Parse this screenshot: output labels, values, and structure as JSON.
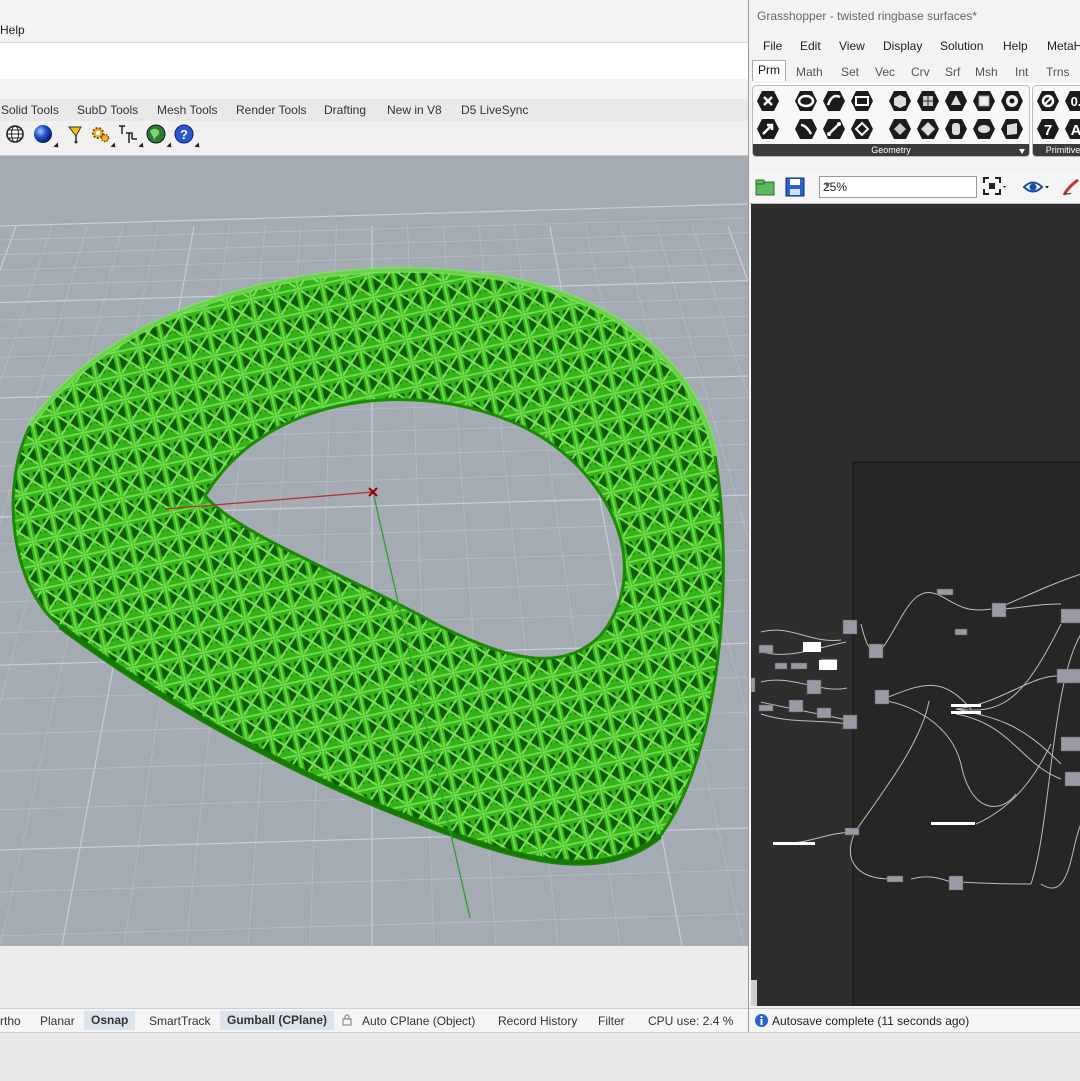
{
  "rhino": {
    "menu": {
      "help": "Help"
    },
    "tabs": [
      "Solid Tools",
      "SubD Tools",
      "Mesh Tools",
      "Render Tools",
      "Drafting",
      "New in V8",
      "D5 LiveSync"
    ],
    "toolbar_icons": [
      "globe-wireframe-icon",
      "render-sphere-icon",
      "lamp-light-icon",
      "gear-settings-icon",
      "cplane-text-icon",
      "earth-icon",
      "help-question-icon"
    ],
    "status": [
      "rtho",
      "Planar",
      "Osnap",
      "SmartTrack",
      "Gumball (CPlane)",
      "Auto CPlane (Object)",
      "Record History",
      "Filter",
      "CPU use: 2.4 %"
    ],
    "status_active": [
      "Osnap",
      "Gumball (CPlane)"
    ],
    "model_color": "#3fc31b",
    "viewport_color": "#a4abb3"
  },
  "grasshopper": {
    "title": "Grasshopper - twisted ringbase surfaces*",
    "menu": [
      "File",
      "Edit",
      "View",
      "Display",
      "Solution",
      "Help",
      "MetaH"
    ],
    "tabs": [
      "Prm",
      "Math",
      "Set",
      "Vec",
      "Crv",
      "Srf",
      "Msh",
      "Int",
      "Trns"
    ],
    "active_tab": "Prm",
    "ribbon_groups": [
      "Geometry",
      "Primitive"
    ],
    "primitive_values": [
      "7",
      "A"
    ],
    "zoom": "25%",
    "status": "Autosave complete (11 seconds ago)",
    "canvas_color": "#2e2e2e"
  }
}
